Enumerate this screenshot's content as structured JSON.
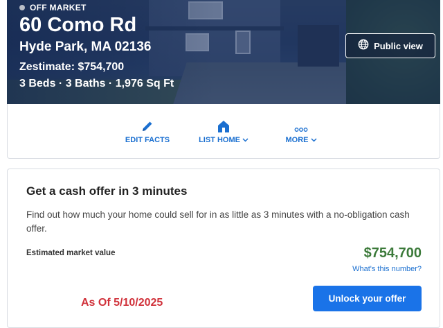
{
  "header": {
    "status": "OFF MARKET",
    "street": "60 Como Rd",
    "city_line": "Hyde Park, MA 02136",
    "zestimate": "Zestimate: $754,700",
    "facts": "3 Beds · 3 Baths · 1,976 Sq Ft",
    "public_view_label": "Public view",
    "public_view_icon": "globe-icon"
  },
  "actions": [
    {
      "label": "EDIT FACTS",
      "icon": "pencil-icon",
      "has_dropdown": false
    },
    {
      "label": "LIST HOME",
      "icon": "house-icon",
      "has_dropdown": true
    },
    {
      "label": "MORE",
      "icon": "more-dots-icon",
      "has_dropdown": true
    }
  ],
  "cash_offer": {
    "title": "Get a cash offer in 3 minutes",
    "description": "Find out how much your home could sell for in as little as 3 minutes with a no-obligation cash offer.",
    "estimated_label": "Estimated market value",
    "estimated_value": "$754,700",
    "whats_this": "What's this number?",
    "as_of": "As Of 5/10/2025",
    "button_label": "Unlock your offer"
  },
  "colors": {
    "accent_blue": "#1a73e8",
    "link_blue": "#1a6fd0",
    "value_green": "#3c7a3a",
    "date_red": "#d0313a"
  }
}
